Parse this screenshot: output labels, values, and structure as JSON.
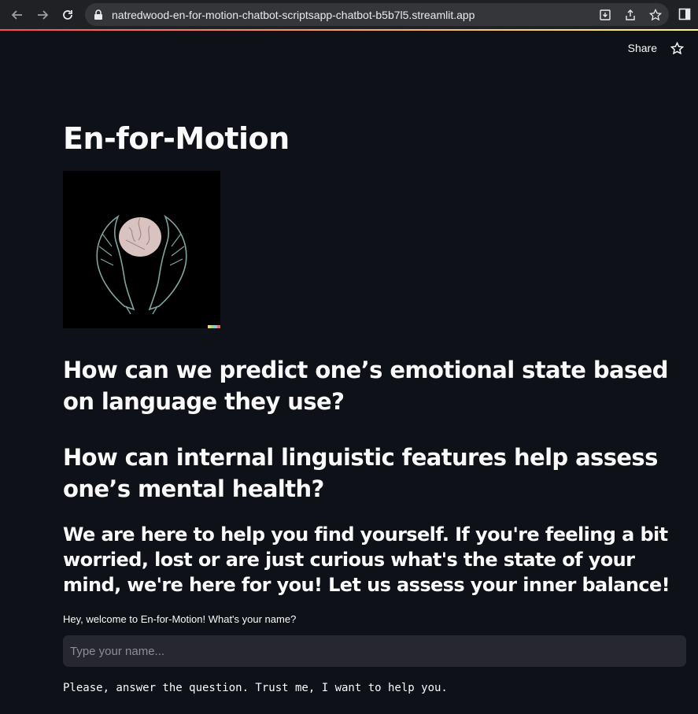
{
  "browser": {
    "url": "natredwood-en-for-motion-chatbot-scriptsapp-chatbot-b5b7l5.streamlit.app"
  },
  "toolbar": {
    "share_label": "Share"
  },
  "page": {
    "title": "En-for-Motion",
    "question_1": "How can we predict one’s emotional state based on language they use?",
    "question_2": "How can internal linguistic features help assess one’s mental health?",
    "intro": "We are here to help you find yourself. If you're feeling a bit worried, lost or are just curious what's the state of your mind, we're here for you! Let us assess your inner balance!",
    "name_prompt": "Hey, welcome to En-for-Motion! What's your name?",
    "name_placeholder": "Type your name...",
    "name_value": "",
    "response": "Please, answer the question. Trust me, I want to help you."
  },
  "colors": {
    "background": "#0e1117",
    "input_background": "#262730",
    "accent": "#ff4b4b"
  }
}
